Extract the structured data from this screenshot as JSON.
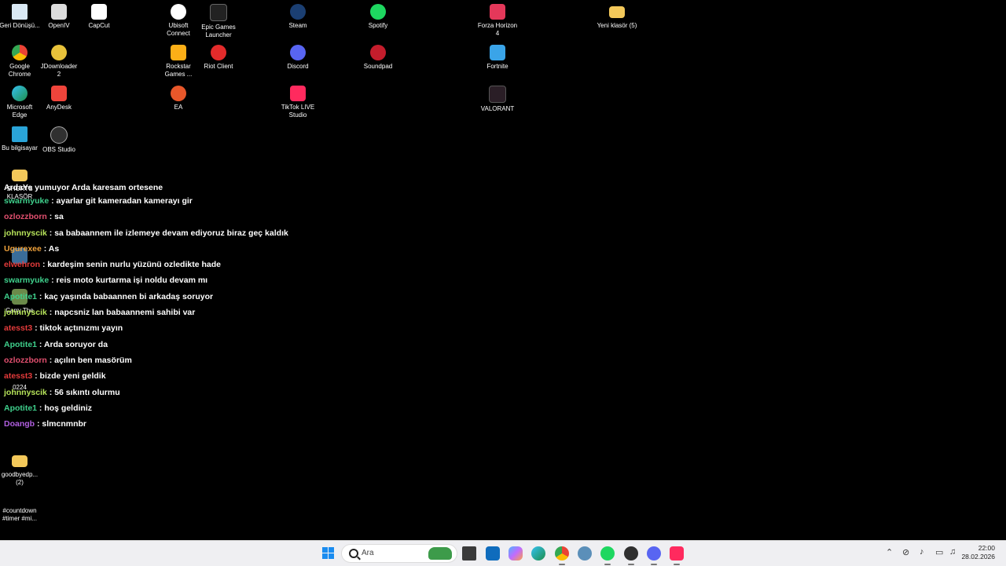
{
  "desktop": {
    "icons": [
      {
        "label": "Geri Dönüşü...",
        "icon": "recycle-bin-icon"
      },
      {
        "label": "OpenIV",
        "icon": "openiv-icon"
      },
      {
        "label": "CapCut",
        "icon": "capcut-icon"
      },
      {
        "label": "Ubisoft Connect",
        "icon": "ubisoft-icon"
      },
      {
        "label": "Epic Games Launcher",
        "icon": "epic-games-icon"
      },
      {
        "label": "Steam",
        "icon": "steam-icon"
      },
      {
        "label": "Spotify",
        "icon": "spotify-icon"
      },
      {
        "label": "Forza Horizon 4",
        "icon": "forza-icon"
      },
      {
        "label": "Yeni klasör (5)",
        "icon": "folder-icon"
      },
      {
        "label": "Google Chrome",
        "icon": "chrome-icon"
      },
      {
        "label": "JDownloader 2",
        "icon": "jdownloader-icon"
      },
      {
        "label": "Rockstar Games ...",
        "icon": "rockstar-icon"
      },
      {
        "label": "Riot Client",
        "icon": "riot-icon"
      },
      {
        "label": "Discord",
        "icon": "discord-icon"
      },
      {
        "label": "Soundpad",
        "icon": "soundpad-icon"
      },
      {
        "label": "Fortnite",
        "icon": "fortnite-icon"
      },
      {
        "label": "Microsoft Edge",
        "icon": "edge-icon"
      },
      {
        "label": "AnyDesk",
        "icon": "anydesk-icon"
      },
      {
        "label": "EA",
        "icon": "ea-icon"
      },
      {
        "label": "TikTok LIVE Studio",
        "icon": "tiktok-live-icon"
      },
      {
        "label": "VALORANT",
        "icon": "valorant-icon"
      },
      {
        "label": "Bu bilgisayar",
        "icon": "computer-icon"
      },
      {
        "label": "OBS Studio",
        "icon": "obs-icon"
      },
      {
        "label": "SHORTS KLASÖR",
        "icon": "folder-icon"
      },
      {
        "label": "Carry The",
        "icon": "image-icon"
      },
      {
        "label": "0224",
        "icon": "file-icon"
      },
      {
        "label": "goodbyedp... (2)",
        "icon": "folder-icon"
      },
      {
        "label": "#countdown #timer #mi...",
        "icon": "video-file-icon"
      }
    ]
  },
  "chat": {
    "partial_line": "ArdaYe yumuyor Arda karesam ortesene",
    "messages": [
      {
        "user": "swarmyuke",
        "user_color": "#3fd08c",
        "text": ": ayarlar git kameradan kamerayı gir"
      },
      {
        "user": "ozlozzborn",
        "user_color": "#e2506f",
        "text": ": sa"
      },
      {
        "user": "johnnyscik",
        "user_color": "#b6e35a",
        "text": ": sa babaannem ile izlemeye devam ediyoruz biraz geç kaldık"
      },
      {
        "user": "Ugurexee",
        "user_color": "#f0a23b",
        "text": ": As"
      },
      {
        "user": "elwehron",
        "user_color": "#e43b3b",
        "text": ": kardeşim senin nurlu yüzünü ozledikte hade"
      },
      {
        "user": "swarmyuke",
        "user_color": "#3fd08c",
        "text": ": reis moto kurtarma işi noldu devam mı"
      },
      {
        "user": "Apotite1",
        "user_color": "#3fd08c",
        "text": ": kaç yaşında babaannen bi arkadaş soruyor"
      },
      {
        "user": "johnnyscik",
        "user_color": "#b6e35a",
        "text": ": napcsniz lan babaannemi sahibi var"
      },
      {
        "user": "atesst3",
        "user_color": "#e43b3b",
        "text": ": tiktok açtınızmı yayın"
      },
      {
        "user": "Apotite1",
        "user_color": "#3fd08c",
        "text": ": Arda soruyor da"
      },
      {
        "user": "ozlozzborn",
        "user_color": "#e2506f",
        "text": ": açılın ben masörüm"
      },
      {
        "user": "atesst3",
        "user_color": "#e43b3b",
        "text": ": bizde yeni geldik"
      },
      {
        "user": "johnnyscik",
        "user_color": "#b6e35a",
        "text": ": 56 sıkıntı olurmu"
      },
      {
        "user": "Apotite1",
        "user_color": "#3fd08c",
        "text": ": hoş geldiniz"
      },
      {
        "user": "Doangb",
        "user_color": "#b15fe0",
        "text": ": slmcnmnbr"
      }
    ]
  },
  "taskbar": {
    "search_placeholder": "Ara",
    "apps": [
      "file-explorer-icon",
      "outlook-icon",
      "copilot-icon",
      "edge-icon",
      "chrome-icon",
      "settings-icon",
      "spotify-icon",
      "obs-icon",
      "discord-icon",
      "tiktok-live-icon"
    ],
    "clock_time": "22:00",
    "clock_date": "28.02.2026"
  }
}
